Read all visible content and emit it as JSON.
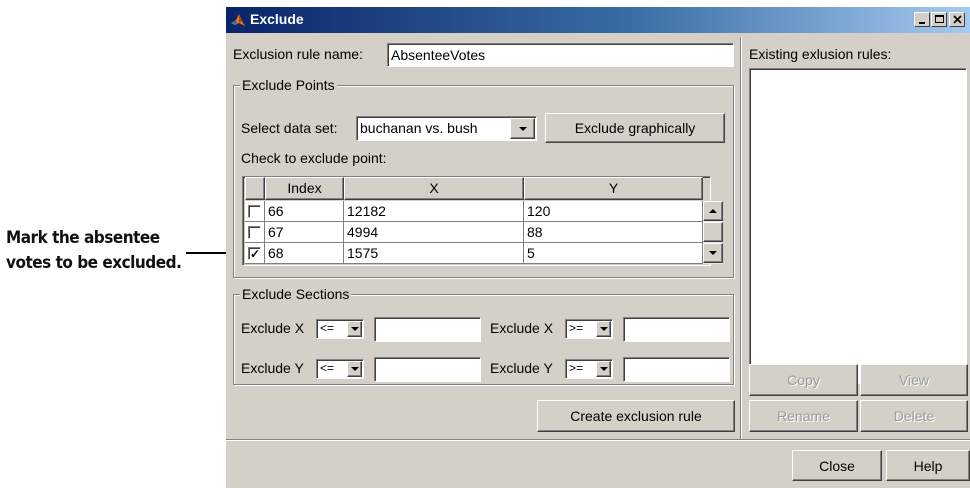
{
  "annotation": {
    "line1": "Mark the absentee",
    "line2": "votes to be excluded."
  },
  "window": {
    "title": "Exclude",
    "controls": {
      "minimize": "_",
      "maximize": "□",
      "close": "x"
    }
  },
  "rule_name": {
    "label": "Exclusion rule name:",
    "value": "AbsenteeVotes"
  },
  "exclude_points": {
    "title": "Exclude Points",
    "select_label": "Select data set:",
    "data_set": "buchanan vs. bush",
    "graphical_button": "Exclude graphically",
    "check_label": "Check to exclude point:",
    "columns": [
      "Index",
      "X",
      "Y"
    ],
    "rows": [
      {
        "index": "66",
        "x": "12182",
        "y": "120",
        "checked": false
      },
      {
        "index": "67",
        "x": "4994",
        "y": "88",
        "checked": false
      },
      {
        "index": "68",
        "x": "1575",
        "y": "5",
        "checked": true
      }
    ]
  },
  "exclude_sections": {
    "title": "Exclude Sections",
    "x_label": "Exclude X",
    "y_label": "Exclude Y",
    "op_le": "<=",
    "op_ge": ">=",
    "x_low": "",
    "x_high": "",
    "y_low": "",
    "y_high": ""
  },
  "create_button": "Create exclusion rule",
  "existing": {
    "label": "Existing exlusion rules:",
    "copy": "Copy",
    "view": "View",
    "rename": "Rename",
    "delete": "Delete"
  },
  "footer": {
    "close": "Close",
    "help": "Help"
  }
}
